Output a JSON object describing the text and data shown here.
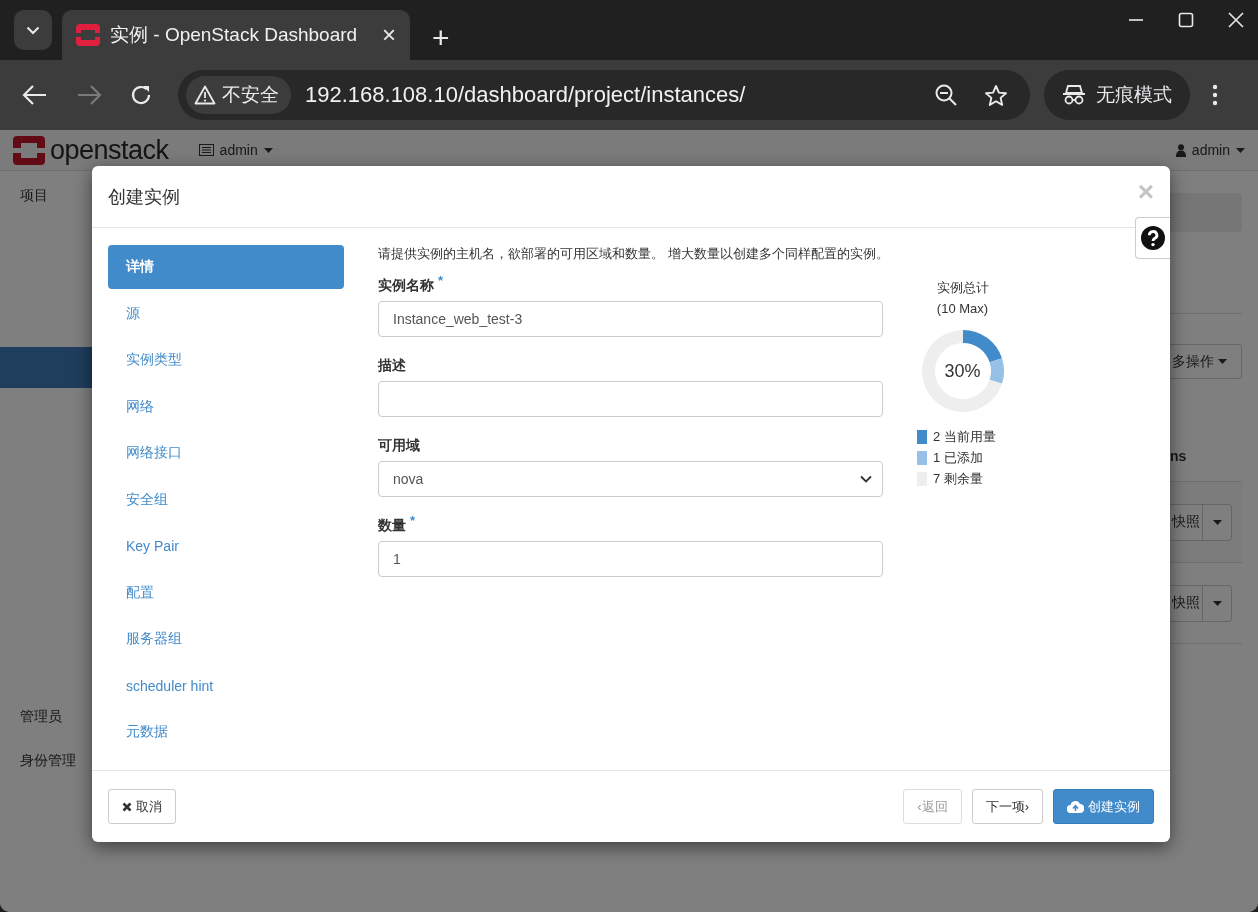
{
  "browser": {
    "tab_title": "实例 - OpenStack Dashboard",
    "tab_close": "×",
    "new_tab": "+",
    "security_label": "不安全",
    "url": "192.168.108.10/dashboard/project/instances/",
    "incognito_label": "无痕模式"
  },
  "header": {
    "logo_text": "openstack",
    "project": "admin",
    "user": "admin"
  },
  "sidebar": {
    "items": [
      {
        "label": "项目"
      },
      {
        "label": "管理员"
      },
      {
        "label": "身份管理"
      }
    ]
  },
  "page_fragments": {
    "actions_button": "多操作",
    "table_heading": "ns",
    "rows": [
      {
        "action": "快照"
      },
      {
        "action": "快照"
      }
    ]
  },
  "modal": {
    "title": "创建实例",
    "close": "×",
    "steps": [
      {
        "label": "详情",
        "selected": true
      },
      {
        "label": "源",
        "selected": false
      },
      {
        "label": "实例类型",
        "selected": false
      },
      {
        "label": "网络",
        "selected": false
      },
      {
        "label": "网络接口",
        "selected": false
      },
      {
        "label": "安全组",
        "selected": false
      },
      {
        "label": "Key Pair",
        "selected": false
      },
      {
        "label": "配置",
        "selected": false
      },
      {
        "label": "服务器组",
        "selected": false
      },
      {
        "label": "scheduler hint",
        "selected": false
      },
      {
        "label": "元数据",
        "selected": false
      }
    ],
    "intro": "请提供实例的主机名，欲部署的可用区域和数量。 增大数量以创建多个同样配置的实例。",
    "fields": [
      {
        "kind": "text",
        "label": "实例名称",
        "required_mark": "*",
        "value": "Instance_web_test-3"
      },
      {
        "kind": "text",
        "label": "描述"
      },
      {
        "kind": "select",
        "label": "可用域",
        "value": "nova"
      },
      {
        "kind": "text",
        "label": "数量",
        "required_mark": "*",
        "value": "1"
      }
    ],
    "summary": {
      "title": "实例总计",
      "subtitle": "(10 Max)",
      "center_label": "30%",
      "chart_data": {
        "type": "donut",
        "values": [
          20,
          10,
          70
        ],
        "colors": [
          "#428bca",
          "#96c0e6",
          "#eeeeee"
        ]
      },
      "legend": [
        {
          "count": "2",
          "label": "当前用量",
          "color": "#428bca"
        },
        {
          "count": "1",
          "label": "已添加",
          "color": "#96c0e6"
        },
        {
          "count": "7",
          "label": "剩余量",
          "color": "#eeeeee"
        }
      ]
    },
    "footer_buttons": [
      {
        "kind": "cancel",
        "label": "取消",
        "disabled": false
      },
      {
        "kind": "back",
        "label": "‹返回",
        "disabled": true
      },
      {
        "kind": "next",
        "label": "下一项›",
        "disabled": false
      },
      {
        "kind": "create",
        "label": "创建实例",
        "disabled": false
      }
    ]
  }
}
